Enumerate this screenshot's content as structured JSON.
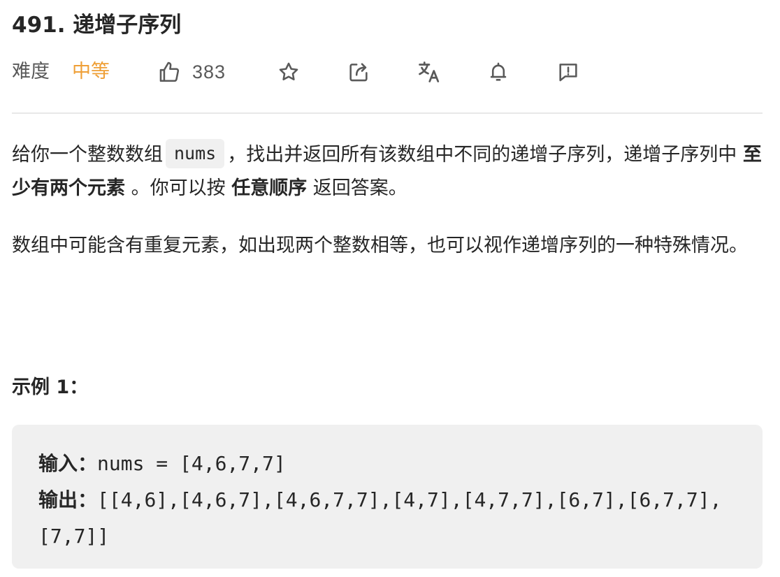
{
  "problem": {
    "title": "491. 递增子序列",
    "difficulty_label": "难度",
    "difficulty_value": "中等",
    "like_count": "383"
  },
  "toolbar": {
    "like_icon": "thumbs-up-icon",
    "favorite_icon": "star-icon",
    "share_icon": "share-icon",
    "translate_icon": "translate-icon",
    "notify_icon": "bell-icon",
    "feedback_icon": "feedback-icon"
  },
  "description": {
    "p1_a": "给你一个整数数组",
    "p1_code": "nums",
    "p1_b": "，找出并返回所有该数组中不同的递增子序列，递增子序列中",
    "p1_bold1": "至少有两个元素",
    "p1_c": "。你可以按",
    "p1_bold2": "任意顺序",
    "p1_d": "返回答案。",
    "p2": "数组中可能含有重复元素，如出现两个整数相等，也可以视作递增序列的一种特殊情况。"
  },
  "example": {
    "title": "示例 1：",
    "input_label": "输入：",
    "input_value": "nums = [4,6,7,7]",
    "output_label": "输出：",
    "output_value": "[[4,6],[4,6,7],[4,6,7,7],[4,7],[4,7,7],[6,7],[6,7,7],[7,7]]"
  },
  "colors": {
    "difficulty_medium": "#ef9f36",
    "text": "#262626",
    "muted": "#595959",
    "code_bg": "#f0f0f0",
    "divider": "#e8e8e8"
  }
}
